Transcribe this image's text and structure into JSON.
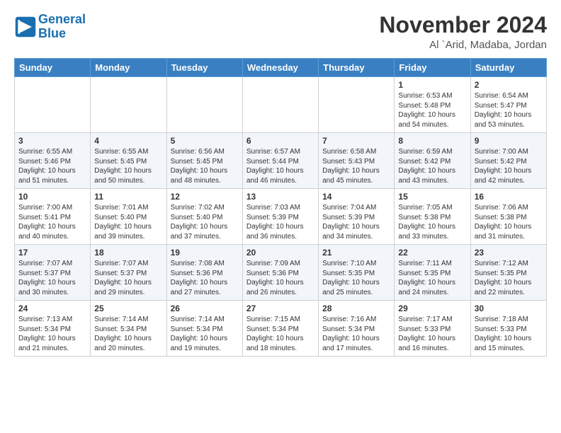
{
  "logo": {
    "line1": "General",
    "line2": "Blue"
  },
  "title": "November 2024",
  "location": "Al `Arid, Madaba, Jordan",
  "weekdays": [
    "Sunday",
    "Monday",
    "Tuesday",
    "Wednesday",
    "Thursday",
    "Friday",
    "Saturday"
  ],
  "weeks": [
    [
      {
        "day": "",
        "info": ""
      },
      {
        "day": "",
        "info": ""
      },
      {
        "day": "",
        "info": ""
      },
      {
        "day": "",
        "info": ""
      },
      {
        "day": "",
        "info": ""
      },
      {
        "day": "1",
        "info": "Sunrise: 6:53 AM\nSunset: 5:48 PM\nDaylight: 10 hours and 54 minutes."
      },
      {
        "day": "2",
        "info": "Sunrise: 6:54 AM\nSunset: 5:47 PM\nDaylight: 10 hours and 53 minutes."
      }
    ],
    [
      {
        "day": "3",
        "info": "Sunrise: 6:55 AM\nSunset: 5:46 PM\nDaylight: 10 hours and 51 minutes."
      },
      {
        "day": "4",
        "info": "Sunrise: 6:55 AM\nSunset: 5:45 PM\nDaylight: 10 hours and 50 minutes."
      },
      {
        "day": "5",
        "info": "Sunrise: 6:56 AM\nSunset: 5:45 PM\nDaylight: 10 hours and 48 minutes."
      },
      {
        "day": "6",
        "info": "Sunrise: 6:57 AM\nSunset: 5:44 PM\nDaylight: 10 hours and 46 minutes."
      },
      {
        "day": "7",
        "info": "Sunrise: 6:58 AM\nSunset: 5:43 PM\nDaylight: 10 hours and 45 minutes."
      },
      {
        "day": "8",
        "info": "Sunrise: 6:59 AM\nSunset: 5:42 PM\nDaylight: 10 hours and 43 minutes."
      },
      {
        "day": "9",
        "info": "Sunrise: 7:00 AM\nSunset: 5:42 PM\nDaylight: 10 hours and 42 minutes."
      }
    ],
    [
      {
        "day": "10",
        "info": "Sunrise: 7:00 AM\nSunset: 5:41 PM\nDaylight: 10 hours and 40 minutes."
      },
      {
        "day": "11",
        "info": "Sunrise: 7:01 AM\nSunset: 5:40 PM\nDaylight: 10 hours and 39 minutes."
      },
      {
        "day": "12",
        "info": "Sunrise: 7:02 AM\nSunset: 5:40 PM\nDaylight: 10 hours and 37 minutes."
      },
      {
        "day": "13",
        "info": "Sunrise: 7:03 AM\nSunset: 5:39 PM\nDaylight: 10 hours and 36 minutes."
      },
      {
        "day": "14",
        "info": "Sunrise: 7:04 AM\nSunset: 5:39 PM\nDaylight: 10 hours and 34 minutes."
      },
      {
        "day": "15",
        "info": "Sunrise: 7:05 AM\nSunset: 5:38 PM\nDaylight: 10 hours and 33 minutes."
      },
      {
        "day": "16",
        "info": "Sunrise: 7:06 AM\nSunset: 5:38 PM\nDaylight: 10 hours and 31 minutes."
      }
    ],
    [
      {
        "day": "17",
        "info": "Sunrise: 7:07 AM\nSunset: 5:37 PM\nDaylight: 10 hours and 30 minutes."
      },
      {
        "day": "18",
        "info": "Sunrise: 7:07 AM\nSunset: 5:37 PM\nDaylight: 10 hours and 29 minutes."
      },
      {
        "day": "19",
        "info": "Sunrise: 7:08 AM\nSunset: 5:36 PM\nDaylight: 10 hours and 27 minutes."
      },
      {
        "day": "20",
        "info": "Sunrise: 7:09 AM\nSunset: 5:36 PM\nDaylight: 10 hours and 26 minutes."
      },
      {
        "day": "21",
        "info": "Sunrise: 7:10 AM\nSunset: 5:35 PM\nDaylight: 10 hours and 25 minutes."
      },
      {
        "day": "22",
        "info": "Sunrise: 7:11 AM\nSunset: 5:35 PM\nDaylight: 10 hours and 24 minutes."
      },
      {
        "day": "23",
        "info": "Sunrise: 7:12 AM\nSunset: 5:35 PM\nDaylight: 10 hours and 22 minutes."
      }
    ],
    [
      {
        "day": "24",
        "info": "Sunrise: 7:13 AM\nSunset: 5:34 PM\nDaylight: 10 hours and 21 minutes."
      },
      {
        "day": "25",
        "info": "Sunrise: 7:14 AM\nSunset: 5:34 PM\nDaylight: 10 hours and 20 minutes."
      },
      {
        "day": "26",
        "info": "Sunrise: 7:14 AM\nSunset: 5:34 PM\nDaylight: 10 hours and 19 minutes."
      },
      {
        "day": "27",
        "info": "Sunrise: 7:15 AM\nSunset: 5:34 PM\nDaylight: 10 hours and 18 minutes."
      },
      {
        "day": "28",
        "info": "Sunrise: 7:16 AM\nSunset: 5:34 PM\nDaylight: 10 hours and 17 minutes."
      },
      {
        "day": "29",
        "info": "Sunrise: 7:17 AM\nSunset: 5:33 PM\nDaylight: 10 hours and 16 minutes."
      },
      {
        "day": "30",
        "info": "Sunrise: 7:18 AM\nSunset: 5:33 PM\nDaylight: 10 hours and 15 minutes."
      }
    ]
  ]
}
